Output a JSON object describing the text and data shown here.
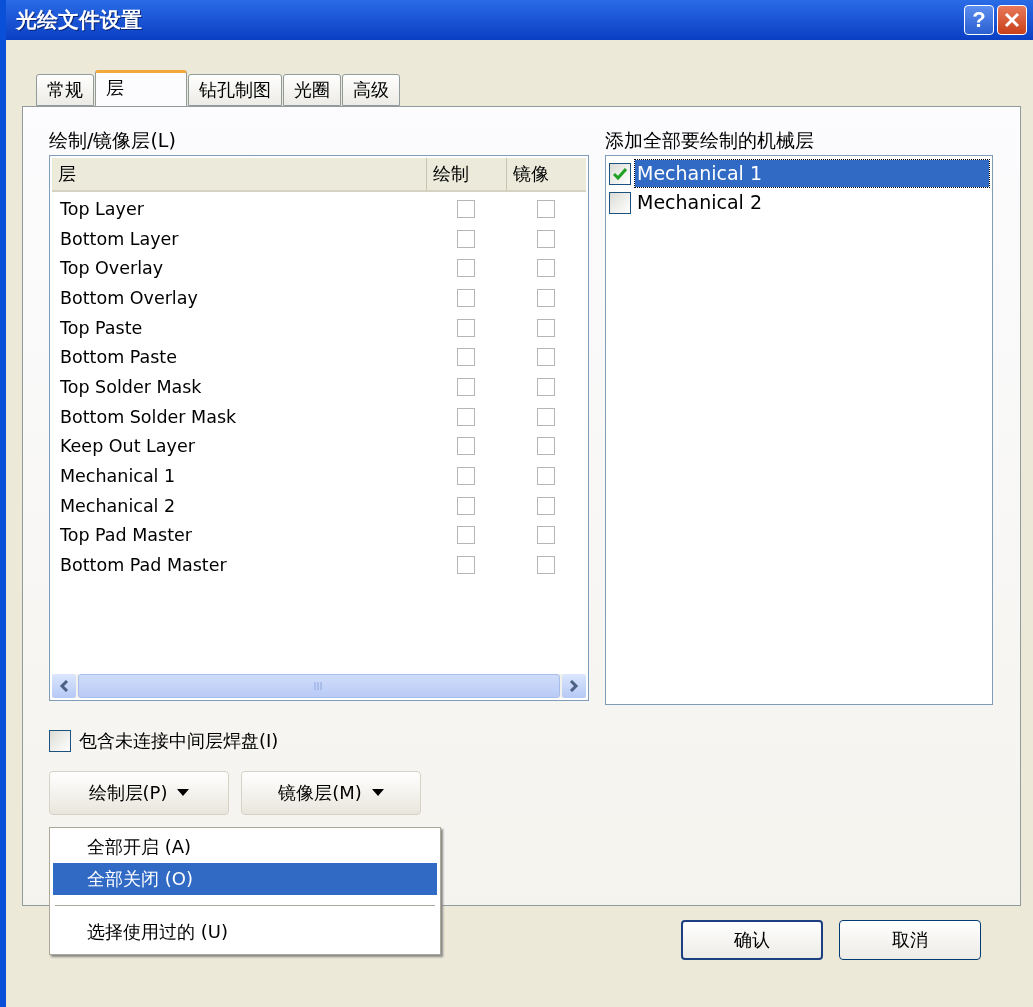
{
  "window": {
    "title": "光绘文件设置",
    "help": "?"
  },
  "tabs": [
    {
      "label": "常规",
      "selected": false
    },
    {
      "label": "层",
      "selected": true
    },
    {
      "label": "钻孔制图",
      "selected": false
    },
    {
      "label": "光圈",
      "selected": false
    },
    {
      "label": "高级",
      "selected": false
    }
  ],
  "layer_list": {
    "label": "绘制/镜像层(L)",
    "columns": [
      "层",
      "绘制",
      "镜像"
    ],
    "rows": [
      {
        "name": "Top Layer",
        "plot": false,
        "mirror": false
      },
      {
        "name": "Bottom Layer",
        "plot": false,
        "mirror": false
      },
      {
        "name": "Top Overlay",
        "plot": false,
        "mirror": false
      },
      {
        "name": "Bottom Overlay",
        "plot": false,
        "mirror": false
      },
      {
        "name": "Top Paste",
        "plot": false,
        "mirror": false
      },
      {
        "name": "Bottom Paste",
        "plot": false,
        "mirror": false
      },
      {
        "name": "Top Solder Mask",
        "plot": false,
        "mirror": false
      },
      {
        "name": "Bottom Solder Mask",
        "plot": false,
        "mirror": false
      },
      {
        "name": "Keep Out Layer",
        "plot": false,
        "mirror": false
      },
      {
        "name": "Mechanical 1",
        "plot": false,
        "mirror": false
      },
      {
        "name": "Mechanical 2",
        "plot": false,
        "mirror": false
      },
      {
        "name": "Top Pad Master",
        "plot": false,
        "mirror": false
      },
      {
        "name": "Bottom Pad Master",
        "plot": false,
        "mirror": false
      }
    ]
  },
  "mechanical": {
    "label": "添加全部要绘制的机械层",
    "items": [
      {
        "label": "Mechanical 1",
        "checked": true,
        "selected": true
      },
      {
        "label": "Mechanical 2",
        "checked": false,
        "selected": false
      }
    ]
  },
  "include_pads": {
    "label": "包含未连接中间层焊盘(I)",
    "checked": false
  },
  "layer_buttons": [
    {
      "label": "绘制层(P)"
    },
    {
      "label": "镜像层(M)"
    }
  ],
  "menu": [
    {
      "kind": "item",
      "label": "全部开启 (A)",
      "selected": false
    },
    {
      "kind": "item",
      "label": "全部关闭 (O)",
      "selected": true
    },
    {
      "kind": "separator"
    },
    {
      "kind": "item",
      "label": "选择使用过的 (U)",
      "selected": false
    }
  ],
  "dialog_buttons": [
    "确认",
    "取消"
  ]
}
